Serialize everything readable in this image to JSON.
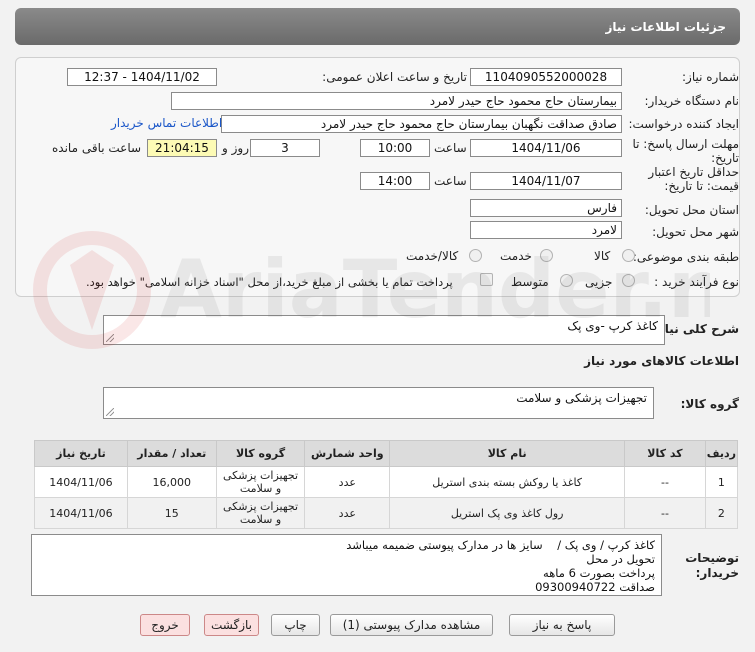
{
  "header": {
    "title": "جزئیات اطلاعات نیاز"
  },
  "form": {
    "need_number_label": "شماره نیاز:",
    "need_number": "1104090552000028",
    "announce_label": "تاریخ و ساعت اعلان عمومی:",
    "announce_value": "1404/11/02 - 12:37",
    "buyer_org_label": "نام دستگاه خریدار:",
    "buyer_org": "بیمارستان حاج محمود حاج حیدر لامرد",
    "requester_label": "ایجاد کننده درخواست:",
    "requester": "صادق صداقت نگهبان بیمارستان حاج محمود حاج حیدر لامرد",
    "contact_link": "اطلاعات تماس خریدار",
    "deadline_label_1": "مهلت ارسال پاسخ: تا",
    "deadline_label_2": "تاریخ:",
    "deadline_date": "1404/11/06",
    "time_word": "ساعت",
    "deadline_time": "10:00",
    "days_value": "3",
    "days_word": "روز و",
    "remaining_time": "21:04:15",
    "remaining_label": "ساعت باقی مانده",
    "validity_label_1": "حداقل تاریخ اعتبار",
    "validity_label_2": "قیمت: تا تاریخ:",
    "validity_date": "1404/11/07",
    "validity_time": "14:00",
    "province_label": "استان محل تحویل:",
    "province": "فارس",
    "city_label": "شهر محل تحویل:",
    "city": "لامرد",
    "category_label": "طبقه بندی موضوعی:",
    "category_options": [
      "کالا",
      "خدمت",
      "کالا/خدمت"
    ],
    "process_label": "نوع فرآیند خرید :",
    "process_options": [
      "جزیی",
      "متوسط"
    ],
    "payment_note": "پرداخت تمام یا بخشی از مبلغ خرید،از محل \"اسناد خزانه اسلامی\" خواهد بود."
  },
  "summary": {
    "label": "شرح کلی نیاز:",
    "value": "کاغذ کرپ -وی پک"
  },
  "goods": {
    "section_title": "اطلاعات کالاهای مورد نیاز",
    "group_label": "گروه کالا:",
    "group_value": "تجهیزات پزشکی و سلامت"
  },
  "table": {
    "headers": [
      "ردیف",
      "کد کالا",
      "نام کالا",
      "واحد شمارش",
      "گروه کالا",
      "تعداد / مقدار",
      "تاریخ نیاز"
    ],
    "rows": [
      [
        "1",
        "--",
        "کاغذ یا روکش بسته بندی استریل",
        "عدد",
        "تجهیزات پزشکی و سلامت",
        "16,000",
        "1404/11/06"
      ],
      [
        "2",
        "--",
        "رول کاغذ وی پک استریل",
        "عدد",
        "تجهیزات پزشکی و سلامت",
        "15",
        "1404/11/06"
      ]
    ]
  },
  "buyer_notes": {
    "label_1": "توضیحات",
    "label_2": "خریدار:",
    "lines": [
      "کاغذ کرپ / وی پک /    سایز ها در مدارک پیوستی ضمیمه میباشد",
      "تحویل در محل",
      "پرداخت بصورت 6 ماهه",
      "صداقت 09300940722"
    ]
  },
  "buttons": {
    "reply": "پاسخ به نیاز",
    "attachments": "مشاهده مدارک پیوستی (1)",
    "print": "چاپ",
    "back": "بازگشت",
    "exit": "خروج"
  },
  "watermark_text": "AriaTender.net"
}
